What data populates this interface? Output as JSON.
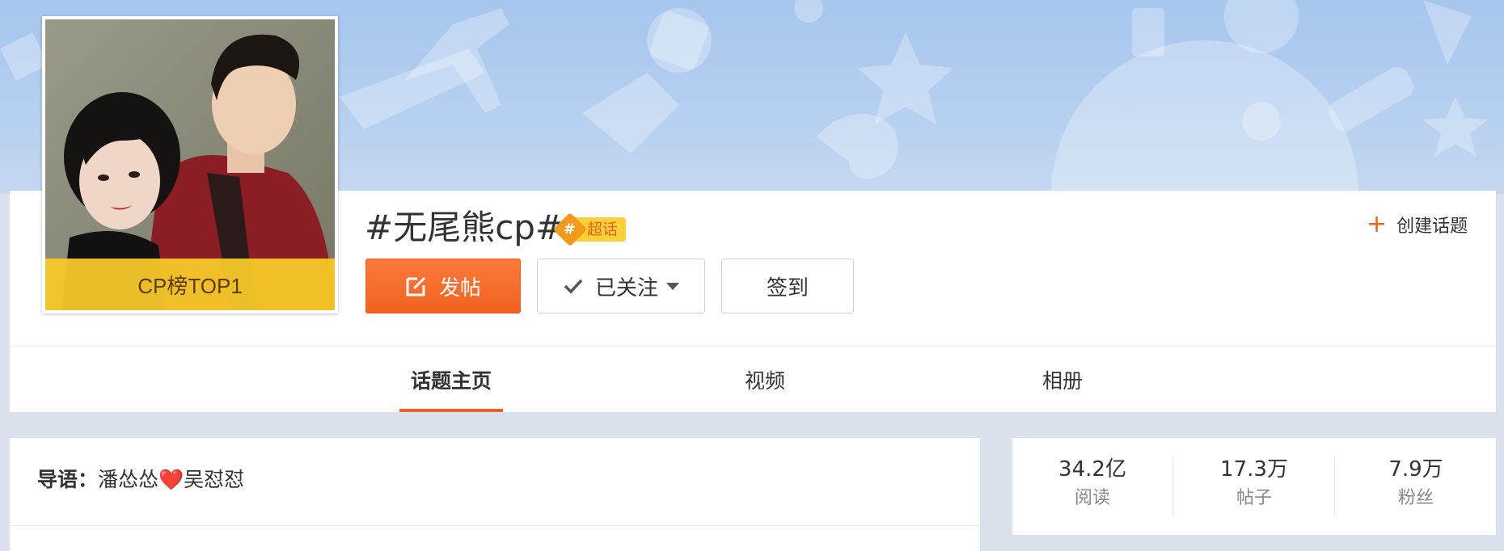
{
  "cover": {
    "badge": "CP榜TOP1"
  },
  "topic": {
    "title": "#无尾熊cp#",
    "super_badge": {
      "symbol": "#",
      "label": "超话"
    }
  },
  "actions": {
    "post_label": "发帖",
    "follow_label": "已关注",
    "signin_label": "签到",
    "create_topic_label": "创建话题"
  },
  "tabs": [
    {
      "label": "话题主页",
      "active": true
    },
    {
      "label": "视频",
      "active": false
    },
    {
      "label": "相册",
      "active": false
    }
  ],
  "intro": {
    "label": "导语：",
    "text": "潘怂怂❤️吴怼怼"
  },
  "stats": [
    {
      "value": "34.2亿",
      "label": "阅读"
    },
    {
      "value": "17.3万",
      "label": "帖子"
    },
    {
      "value": "7.9万",
      "label": "粉丝"
    }
  ],
  "colors": {
    "accent": "#f0631f",
    "badge_yellow": "#fbd13a",
    "banner_blue": "#a6c6ee"
  }
}
